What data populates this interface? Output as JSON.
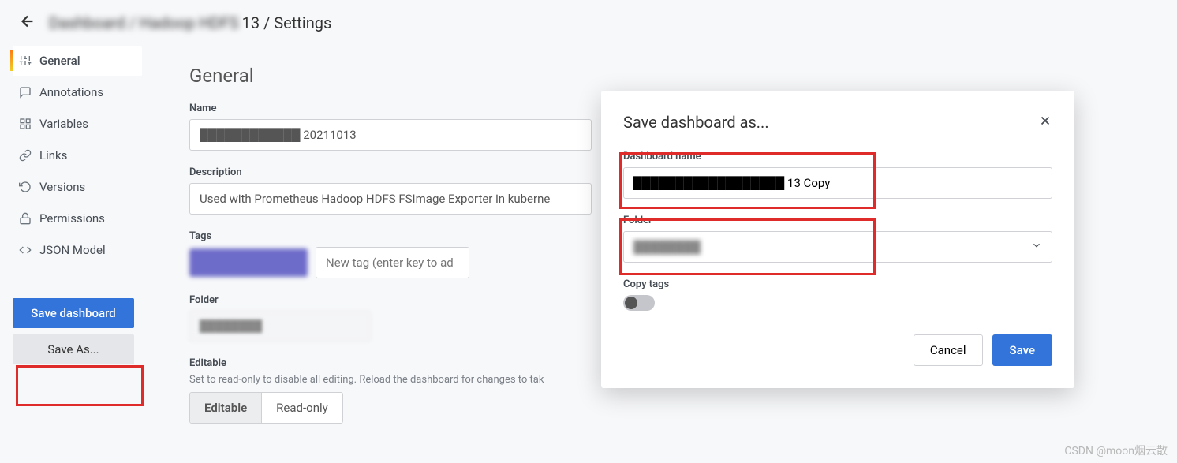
{
  "header": {
    "breadcrumb_obscured": "Dashboard / Hadoop HDFS",
    "breadcrumb_suffix": "13 / Settings"
  },
  "sidebar": {
    "items": [
      {
        "label": "General"
      },
      {
        "label": "Annotations"
      },
      {
        "label": "Variables"
      },
      {
        "label": "Links"
      },
      {
        "label": "Versions"
      },
      {
        "label": "Permissions"
      },
      {
        "label": "JSON Model"
      }
    ],
    "save_dashboard": "Save dashboard",
    "save_as": "Save As..."
  },
  "main": {
    "title": "General",
    "name_label": "Name",
    "name_value": "████████████ 20211013",
    "description_label": "Description",
    "description_value": "Used with Prometheus Hadoop HDFS FSImage Exporter in kuberne",
    "tags_label": "Tags",
    "tag_placeholder": "New tag (enter key to ad",
    "folder_label": "Folder",
    "folder_value": "████████",
    "editable_label": "Editable",
    "editable_sublabel": "Set to read-only to disable all editing. Reload the dashboard for changes to tak",
    "editable_option": "Editable",
    "readonly_option": "Read-only"
  },
  "modal": {
    "title": "Save dashboard as...",
    "dashboard_name_label": "Dashboard name",
    "dashboard_name_value": "██████████████████ 13 Copy",
    "folder_label": "Folder",
    "folder_value": "████████",
    "copy_tags_label": "Copy tags",
    "cancel": "Cancel",
    "save": "Save"
  },
  "watermark": "CSDN @moon烟云散"
}
